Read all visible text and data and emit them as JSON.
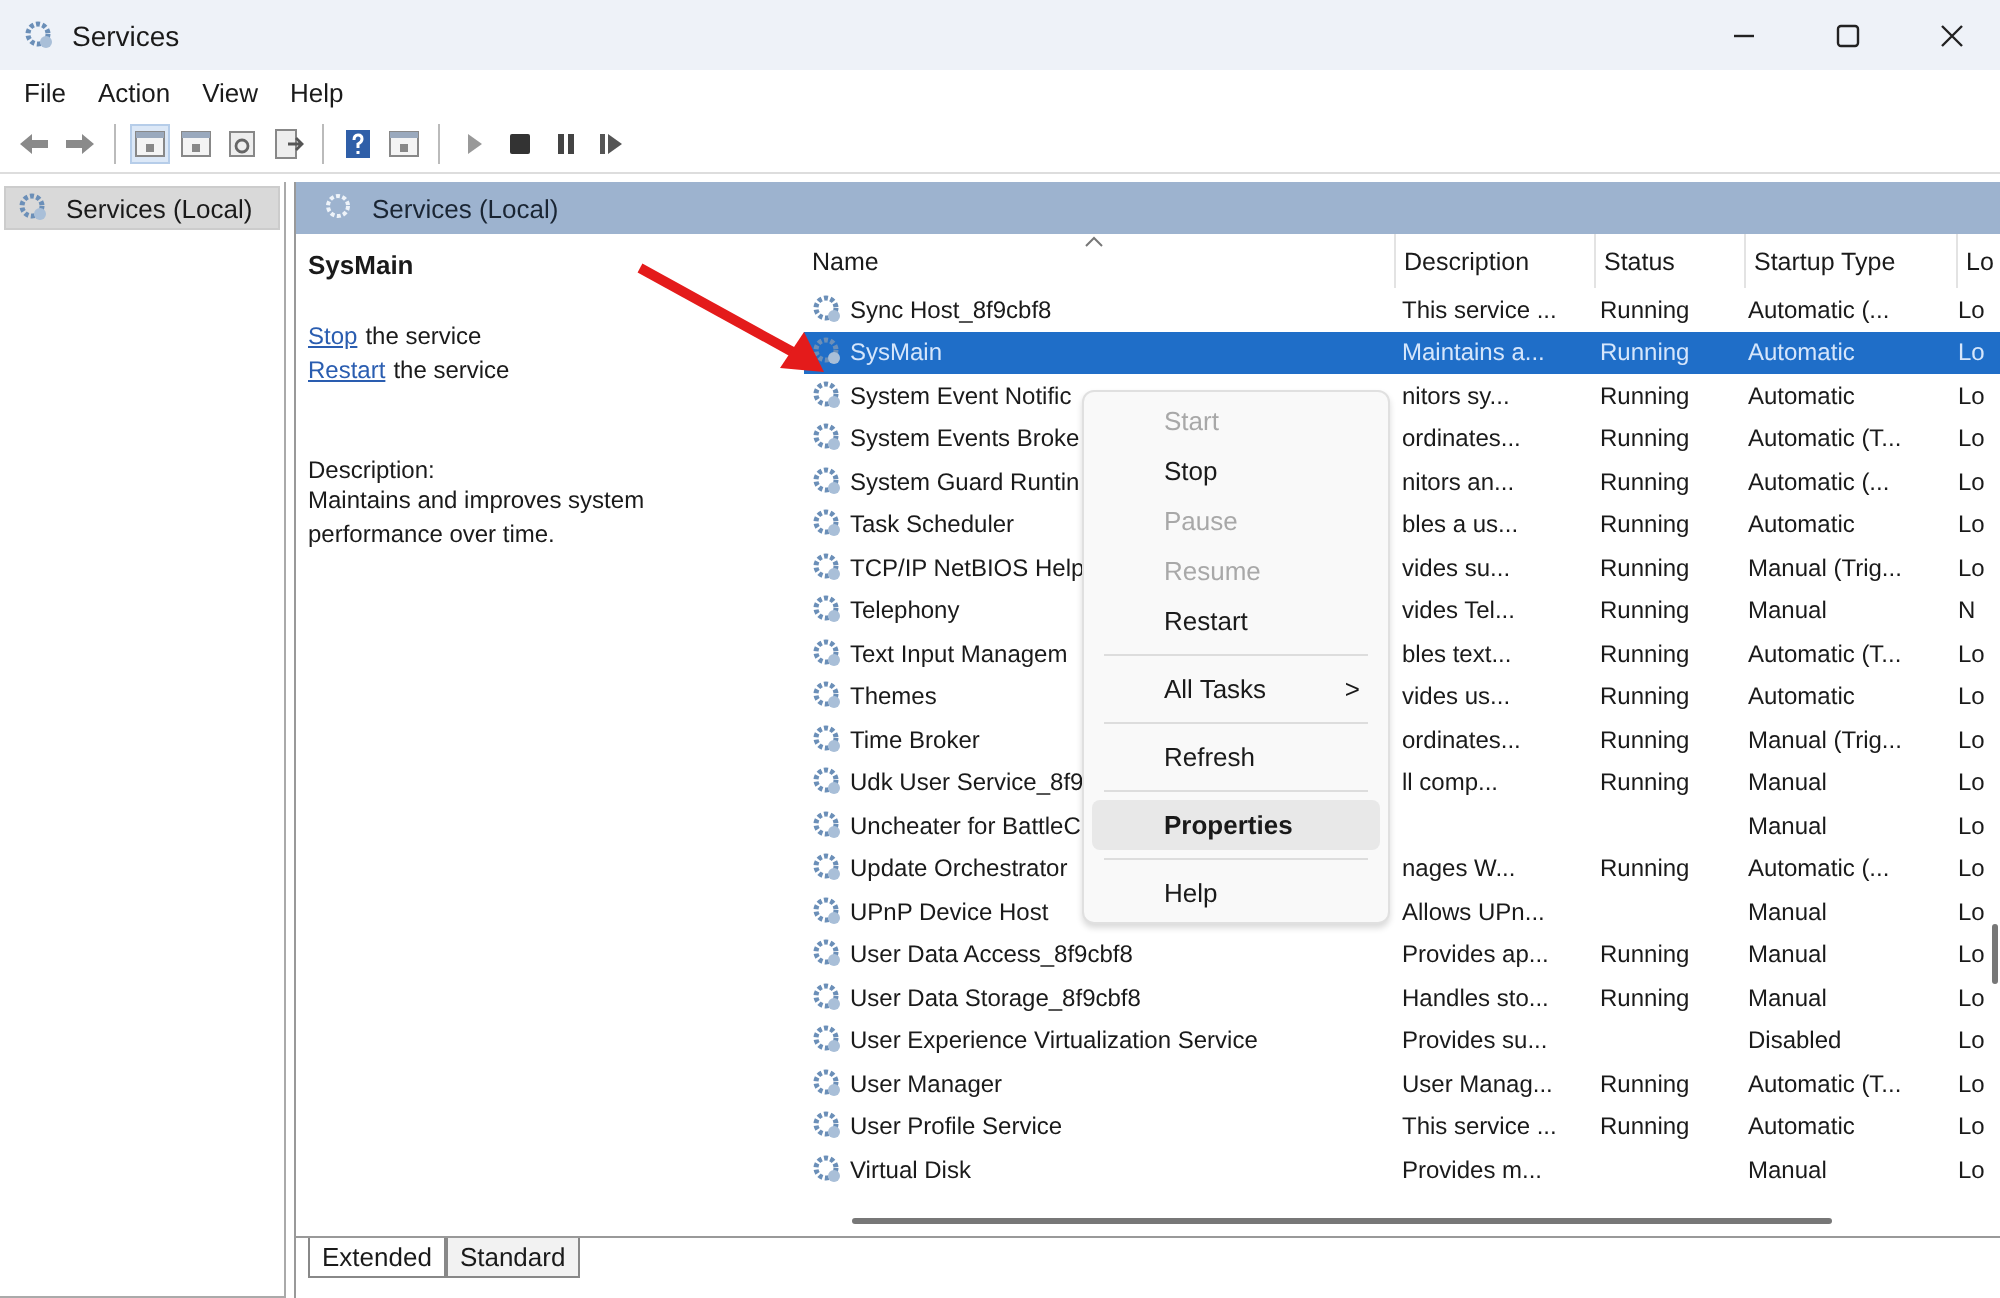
{
  "window": {
    "title": "Services"
  },
  "menu_bar": [
    "File",
    "Action",
    "View",
    "Help"
  ],
  "tree": {
    "items": [
      {
        "label": "Services (Local)",
        "selected": true
      }
    ]
  },
  "pane_header": "Services (Local)",
  "details": {
    "title": "SysMain",
    "actions": [
      {
        "link": "Stop",
        "text": "the service"
      },
      {
        "link": "Restart",
        "text": "the service"
      }
    ],
    "description_label": "Description:",
    "description": "Maintains and improves system performance over time."
  },
  "table": {
    "columns": [
      "Name",
      "Description",
      "Status",
      "Startup Type",
      "Lo"
    ],
    "rows": [
      {
        "name": "Sync Host_8f9cbf8",
        "description": "This service ...",
        "status": "Running",
        "startup": "Automatic (...",
        "log_on": "Lo",
        "selected": false
      },
      {
        "name": "SysMain",
        "description": "Maintains a...",
        "status": "Running",
        "startup": "Automatic",
        "log_on": "Lo",
        "selected": true
      },
      {
        "name": "System Event Notific",
        "description": "nitors sy...",
        "status": "Running",
        "startup": "Automatic",
        "log_on": "Lo",
        "selected": false
      },
      {
        "name": "System Events Broke",
        "description": "ordinates...",
        "status": "Running",
        "startup": "Automatic (T...",
        "log_on": "Lo",
        "selected": false
      },
      {
        "name": "System Guard Runtin",
        "description": "nitors an...",
        "status": "Running",
        "startup": "Automatic (...",
        "log_on": "Lo",
        "selected": false
      },
      {
        "name": "Task Scheduler",
        "description": "bles a us...",
        "status": "Running",
        "startup": "Automatic",
        "log_on": "Lo",
        "selected": false
      },
      {
        "name": "TCP/IP NetBIOS Help",
        "description": "vides su...",
        "status": "Running",
        "startup": "Manual (Trig...",
        "log_on": "Lo",
        "selected": false
      },
      {
        "name": "Telephony",
        "description": "vides Tel...",
        "status": "Running",
        "startup": "Manual",
        "log_on": "N",
        "selected": false
      },
      {
        "name": "Text Input Managem",
        "description": "bles text...",
        "status": "Running",
        "startup": "Automatic (T...",
        "log_on": "Lo",
        "selected": false
      },
      {
        "name": "Themes",
        "description": "vides us...",
        "status": "Running",
        "startup": "Automatic",
        "log_on": "Lo",
        "selected": false
      },
      {
        "name": "Time Broker",
        "description": "ordinates...",
        "status": "Running",
        "startup": "Manual (Trig...",
        "log_on": "Lo",
        "selected": false
      },
      {
        "name": "Udk User Service_8f9",
        "description": "ll comp...",
        "status": "Running",
        "startup": "Manual",
        "log_on": "Lo",
        "selected": false
      },
      {
        "name": "Uncheater for BattleC",
        "startup": "Manual",
        "log_on": "Lo",
        "selected": false
      },
      {
        "name": "Update Orchestrator",
        "description": "nages W...",
        "status": "Running",
        "startup": "Automatic (...",
        "log_on": "Lo",
        "selected": false
      },
      {
        "name": "UPnP Device Host",
        "description": "Allows UPn...",
        "startup": "Manual",
        "log_on": "Lo",
        "selected": false
      },
      {
        "name": "User Data Access_8f9cbf8",
        "description": "Provides ap...",
        "status": "Running",
        "startup": "Manual",
        "log_on": "Lo",
        "selected": false
      },
      {
        "name": "User Data Storage_8f9cbf8",
        "description": "Handles sto...",
        "status": "Running",
        "startup": "Manual",
        "log_on": "Lo",
        "selected": false
      },
      {
        "name": "User Experience Virtualization Service",
        "description": "Provides su...",
        "startup": "Disabled",
        "log_on": "Lo",
        "selected": false
      },
      {
        "name": "User Manager",
        "description": "User Manag...",
        "status": "Running",
        "startup": "Automatic (T...",
        "log_on": "Lo",
        "selected": false
      },
      {
        "name": "User Profile Service",
        "description": "This service ...",
        "status": "Running",
        "startup": "Automatic",
        "log_on": "Lo",
        "selected": false
      },
      {
        "name": "Virtual Disk",
        "description": "Provides m...",
        "startup": "Manual",
        "log_on": "Lo",
        "selected": false
      }
    ]
  },
  "context_menu": [
    {
      "kind": "item",
      "label": "Start",
      "disabled": true,
      "selected": false
    },
    {
      "kind": "item",
      "label": "Stop",
      "disabled": false,
      "selected": false
    },
    {
      "kind": "item",
      "label": "Pause",
      "disabled": true,
      "selected": false
    },
    {
      "kind": "item",
      "label": "Resume",
      "disabled": true,
      "selected": false
    },
    {
      "kind": "item",
      "label": "Restart",
      "disabled": false,
      "selected": false
    },
    {
      "kind": "separator"
    },
    {
      "kind": "submenu",
      "label": "All Tasks",
      "arrow": ">",
      "disabled": false,
      "selected": false
    },
    {
      "kind": "separator"
    },
    {
      "kind": "item",
      "label": "Refresh",
      "disabled": false,
      "selected": false
    },
    {
      "kind": "separator"
    },
    {
      "kind": "item",
      "label": "Properties",
      "disabled": false,
      "selected": true
    },
    {
      "kind": "separator"
    },
    {
      "kind": "item",
      "label": "Help",
      "disabled": false,
      "selected": false
    }
  ],
  "view_tabs": [
    {
      "label": "Extended",
      "selected": true
    },
    {
      "label": "Standard",
      "selected": false
    }
  ]
}
